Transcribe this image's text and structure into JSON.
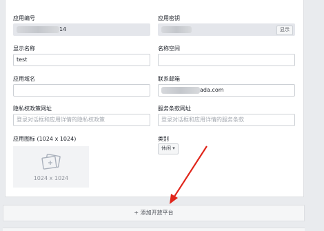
{
  "left_col": {
    "app_id_label": "应用编号",
    "app_id_suffix": "14",
    "display_name_label": "显示名称",
    "display_name_value": "test",
    "app_domain_label": "应用域名",
    "privacy_label": "隐私权政策网址",
    "privacy_placeholder": "登录对话框和应用详情的隐私权政策",
    "icon_label": "应用图标 (1024 x 1024)",
    "icon_size": "1024 x 1024"
  },
  "right_col": {
    "app_secret_label": "应用密钥",
    "show_button": "显示",
    "namespace_label": "名称空间",
    "email_label": "联系邮箱",
    "email_suffix": "ada.com",
    "terms_label": "服务条款网址",
    "terms_placeholder": "登录对话框和应用详情的服务条款",
    "category_label": "类别",
    "category_value": "休闲 ▾"
  },
  "add_platform": "+ 添加开放平台",
  "colors": {
    "annotation_arrow": "#e0261b"
  }
}
